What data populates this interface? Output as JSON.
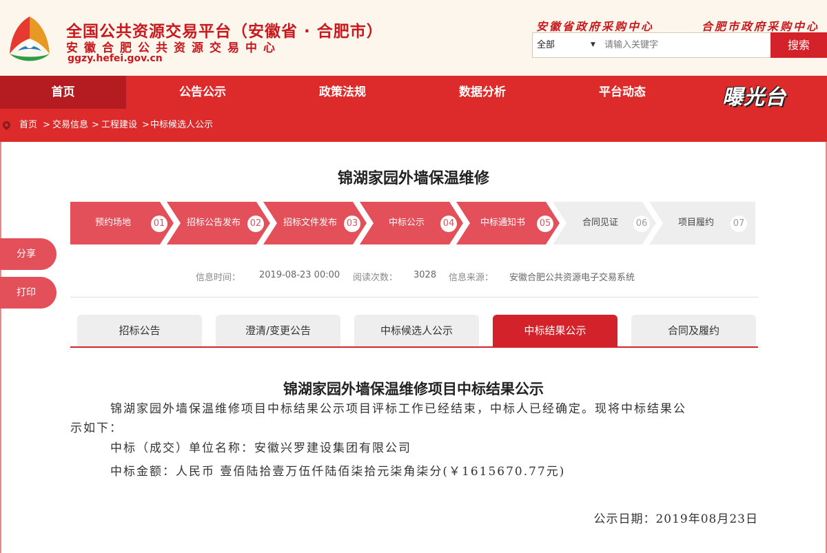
{
  "header": {
    "title": "全国公共资源交易平台（安徽省 · 合肥市）",
    "subtitle": "安徽合肥公共资源交易中心",
    "url": "ggzy.hefei.gov.cn",
    "links": [
      "安徽省政府采购中心",
      "合肥市政府采购中心"
    ],
    "search": {
      "selected": "全部",
      "placeholder": "请输入关键字",
      "button_label": "搜索"
    }
  },
  "nav": {
    "items": [
      "首页",
      "公告公示",
      "政策法规",
      "数据分析",
      "平台动态"
    ],
    "active_index": 0,
    "brand": "曝光台"
  },
  "breadcrumb": [
    "首页",
    ">",
    "交易信息",
    ">",
    "工程建设",
    ">",
    "中标候选人公示"
  ],
  "project_title": "锦湖家园外墙保温维修",
  "steps": [
    {
      "label": "预约场地",
      "num": "01",
      "done": true
    },
    {
      "label": "招标公告发布",
      "num": "02",
      "done": true
    },
    {
      "label": "招标文件发布",
      "num": "03",
      "done": true
    },
    {
      "label": "中标公示",
      "num": "04",
      "done": true
    },
    {
      "label": "中标通知书",
      "num": "05",
      "done": true
    },
    {
      "label": "合同见证",
      "num": "06",
      "done": false
    },
    {
      "label": "项目履约",
      "num": "07",
      "done": false
    }
  ],
  "meta": {
    "time_label": "信息时间：",
    "time_value": "2019-08-23 00:00",
    "views_label": "阅读次数：",
    "views_value": "3028",
    "source_label": "信息来源：",
    "source_value": "安徽合肥公共资源电子交易系统"
  },
  "side": {
    "share": "分享",
    "print": "打印"
  },
  "tabs": [
    "招标公告",
    "澄清/变更公告",
    "中标候选人公示",
    "中标结果公示",
    "合同及履约"
  ],
  "active_tab": 3,
  "article": {
    "title": "锦湖家园外墙保温维修项目中标结果公示",
    "intro_line1": "锦湖家园外墙保温维修项目中标结果公示项目评标工作已经结束，中标人已经确定。现将中标结果公",
    "intro_line2": "示如下：",
    "winner": "中标（成交）单位名称：安徽兴罗建设集团有限公司",
    "amount": "中标金额：人民币 壹佰陆拾壹万伍仟陆佰柒拾元柒角柒分(￥1615670.77元)",
    "date": "公示日期：2019年08月23日"
  },
  "colors": {
    "brand_red": "#d3222a",
    "nav_red": "#dd2b2b",
    "nav_active": "#b51c22",
    "step_done": "#e4505a",
    "step_todo": "#eeeeee",
    "header_bg": "#fdf6ec"
  }
}
